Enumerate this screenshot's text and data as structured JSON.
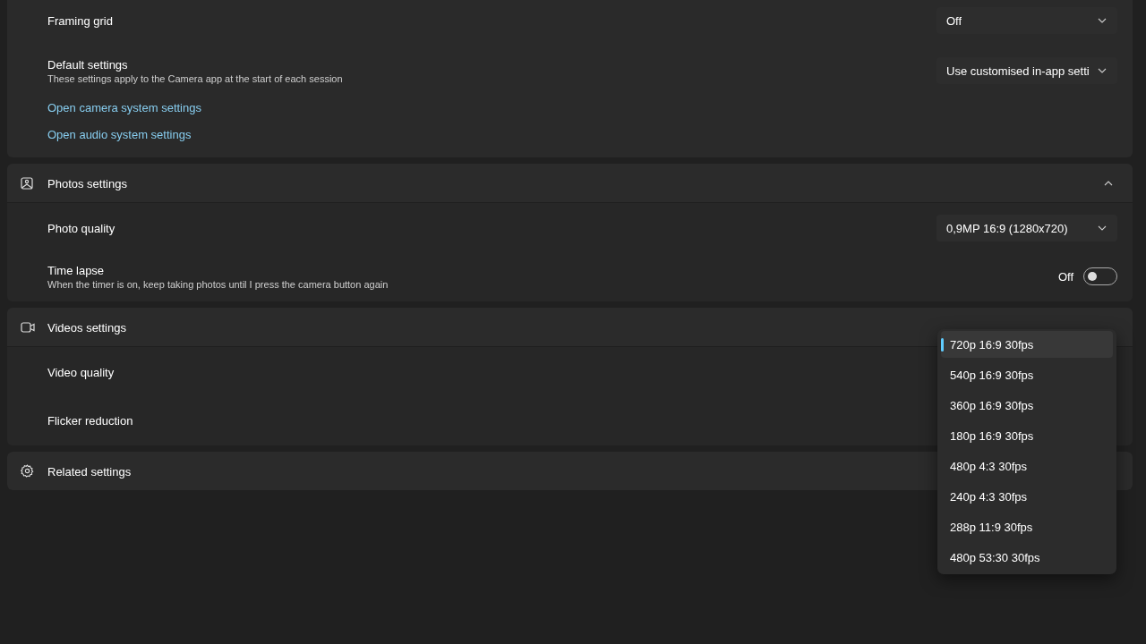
{
  "general": {
    "rows": [
      {
        "kind": "combo",
        "label": "Framing grid",
        "value": "Off"
      },
      {
        "kind": "combo",
        "label": "Default settings",
        "description": "These settings apply to the Camera app at the start of each session",
        "value": "Use customised in-app setti"
      }
    ],
    "links": [
      "Open camera system settings",
      "Open audio system settings"
    ]
  },
  "sections": [
    {
      "title": "Photos settings",
      "expanded": true,
      "rows": [
        {
          "kind": "combo",
          "label": "Photo quality",
          "value": "0,9MP 16:9 (1280x720)"
        },
        {
          "kind": "toggle",
          "label": "Time lapse",
          "description": "When the timer is on, keep taking photos until I press the camera button again",
          "on": false,
          "state_label": "Off"
        }
      ]
    },
    {
      "title": "Videos settings",
      "rows": [
        {
          "kind": "covered",
          "label": "Video quality"
        },
        {
          "kind": "covered",
          "label": "Flicker reduction"
        }
      ]
    },
    {
      "title": "Related settings"
    }
  ],
  "menu": {
    "items": [
      {
        "label": "720p 16:9 30fps",
        "selected": true
      },
      {
        "label": "540p 16:9 30fps",
        "selected": false
      },
      {
        "label": "360p 16:9 30fps",
        "selected": false
      },
      {
        "label": "180p 16:9 30fps",
        "selected": false
      },
      {
        "label": "480p 4:3 30fps",
        "selected": false
      },
      {
        "label": "240p 4:3 30fps",
        "selected": false
      },
      {
        "label": "288p 11:9 30fps",
        "selected": false
      },
      {
        "label": "480p 53:30 30fps",
        "selected": false
      }
    ]
  }
}
